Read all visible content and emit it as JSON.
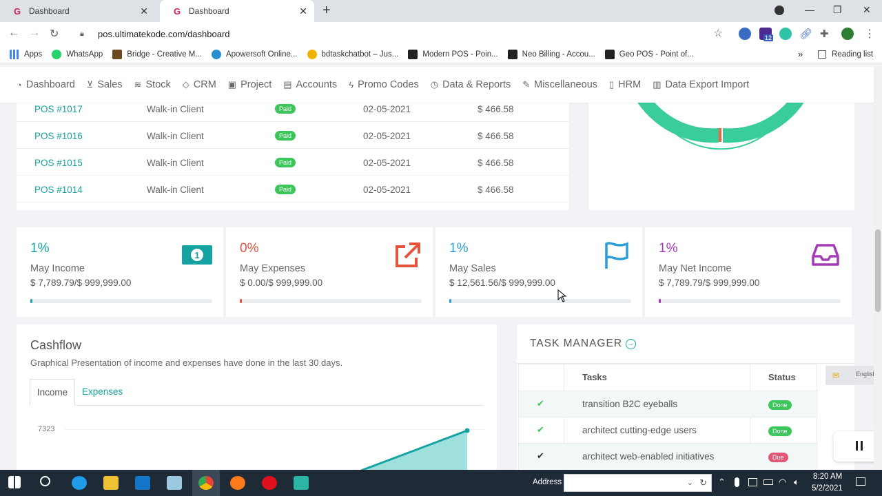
{
  "browser": {
    "tabs": [
      {
        "label": "Dashboard"
      },
      {
        "label": "Dashboard"
      }
    ],
    "url": "pos.ultimatekode.com/dashboard",
    "ext_badge": "12",
    "bookmarks": [
      "Apps",
      "WhatsApp",
      "Bridge - Creative M...",
      "Apowersoft Online...",
      "bdtaskchatbot – Jus...",
      "Modern POS - Poin...",
      "Neo Billing - Accou...",
      "Geo POS - Point of..."
    ],
    "more": "»",
    "reading_list": "Reading list"
  },
  "nav": [
    "Dashboard",
    "Sales",
    "Stock",
    "CRM",
    "Project",
    "Accounts",
    "Promo Codes",
    "Data & Reports",
    "Miscellaneous",
    "HRM",
    "Data Export Import"
  ],
  "invoices": [
    {
      "id": "POS #1017",
      "client": "Walk-in Client",
      "status": "Paid",
      "date": "02-05-2021",
      "amount": "$ 466.58"
    },
    {
      "id": "POS #1016",
      "client": "Walk-in Client",
      "status": "Paid",
      "date": "02-05-2021",
      "amount": "$ 466.58"
    },
    {
      "id": "POS #1015",
      "client": "Walk-in Client",
      "status": "Paid",
      "date": "02-05-2021",
      "amount": "$ 466.58"
    },
    {
      "id": "POS #1014",
      "client": "Walk-in Client",
      "status": "Paid",
      "date": "02-05-2021",
      "amount": "$ 466.58"
    }
  ],
  "stats": [
    {
      "pct": "1%",
      "label": "May Income",
      "value": "$ 7,789.79/$ 999,999.00",
      "color": "#17a2a2",
      "progress": 0.01,
      "icon": "money-icon"
    },
    {
      "pct": "0%",
      "label": "May Expenses",
      "value": "$ 0.00/$ 999,999.00",
      "color": "#e5533d",
      "progress": 0.0,
      "icon": "external-link-icon"
    },
    {
      "pct": "1%",
      "label": "May Sales",
      "value": "$ 12,561.56/$ 999,999.00",
      "color": "#2b9ed8",
      "progress": 0.01,
      "icon": "flag-icon"
    },
    {
      "pct": "1%",
      "label": "May Net Income",
      "value": "$ 7,789.79/$ 999,999.00",
      "color": "#a53ab8",
      "progress": 0.01,
      "icon": "inbox-icon"
    }
  ],
  "cashflow": {
    "title": "Cashflow",
    "subtitle": "Graphical Presentation of income and expenses have done in the last 30 days.",
    "tabs": [
      "Income",
      "Expenses"
    ],
    "y_label": "7323"
  },
  "tasks": {
    "title": "TASK MANAGER",
    "col_task": "Tasks",
    "col_status": "Status",
    "rows": [
      {
        "task": "transition B2C eyeballs",
        "status": "Done",
        "color": "#3cc55a"
      },
      {
        "task": "architect cutting-edge users",
        "status": "Done",
        "color": "#3cc55a"
      },
      {
        "task": "architect web-enabled initiatives",
        "status": "Due",
        "color": "#e05a78"
      }
    ]
  },
  "language": "English",
  "taskbar": {
    "address_label": "Address",
    "time": "8:20 AM",
    "date": "5/2/2021"
  }
}
